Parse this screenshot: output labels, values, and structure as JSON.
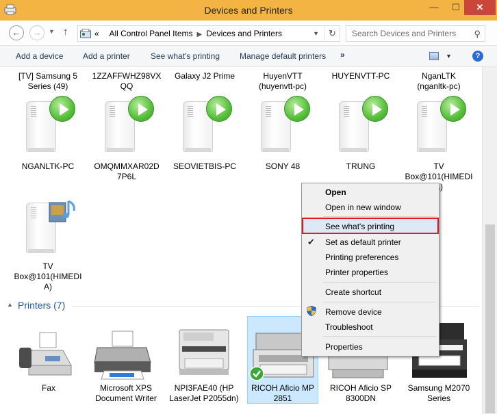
{
  "window": {
    "title": "Devices and Printers",
    "minimize": "—",
    "maximize": "☐",
    "close": "✕"
  },
  "nav": {
    "back": "←",
    "forward": "→",
    "up": "↑",
    "overflow": "«",
    "crumb1": "All Control Panel Items",
    "crumb2": "Devices and Printers",
    "refresh": "↻",
    "search_placeholder": "Search Devices and Printers"
  },
  "commands": {
    "add_device": "Add a device",
    "add_printer": "Add a printer",
    "see_printing": "See what's printing",
    "manage_default": "Manage default printers",
    "more": "»",
    "help": "?"
  },
  "top_row_labels": [
    "[TV] Samsung 5\nSeries (49)",
    "1ZZAFFWHZ98VX\nQQ",
    "Galaxy J2 Prime",
    "HuyenVTT\n(huyenvtt-pc)",
    "HUYENVTT-PC",
    "NganLTK\n(nganltk-pc)"
  ],
  "devices": [
    {
      "name": "NGANLTK-PC"
    },
    {
      "name": "OMQMMXAR02D\n7P6L"
    },
    {
      "name": "SEOVIETBIS-PC"
    },
    {
      "name": "SONY 48"
    },
    {
      "name": "TRUNG"
    },
    {
      "name": "TV\nBox@101(HIMEDI\nA)"
    }
  ],
  "device_row3": {
    "name": "TV\nBox@101(HIMEDI\nA)"
  },
  "printers_section": {
    "title": "Printers (7)"
  },
  "printers": [
    {
      "name": "Fax"
    },
    {
      "name": "Microsoft XPS\nDocument Writer"
    },
    {
      "name": "NPI3FAE40 (HP\nLaserJet P2055dn)"
    },
    {
      "name": "RICOH Aficio MP\n2851",
      "default": true,
      "selected": true
    },
    {
      "name": "RICOH Aficio SP\n8300DN"
    },
    {
      "name": "Samsung M2070\nSeries"
    }
  ],
  "context_menu": {
    "open": "Open",
    "open_new_window": "Open in new window",
    "see_printing": "See what's printing",
    "set_default": "Set as default printer",
    "printing_prefs": "Printing preferences",
    "printer_props": "Printer properties",
    "create_shortcut": "Create shortcut",
    "remove_device": "Remove device",
    "troubleshoot": "Troubleshoot",
    "properties": "Properties",
    "check": "✔"
  },
  "colors": {
    "titlebar": "#f3b443",
    "close_button": "#c9473a",
    "section_title": "#1e5aa8",
    "highlight_box": "#e3181f",
    "selection": "#cce8ff"
  },
  "icons": {
    "search": "search-icon",
    "play": "play-icon",
    "shield": "uac-shield-icon"
  }
}
